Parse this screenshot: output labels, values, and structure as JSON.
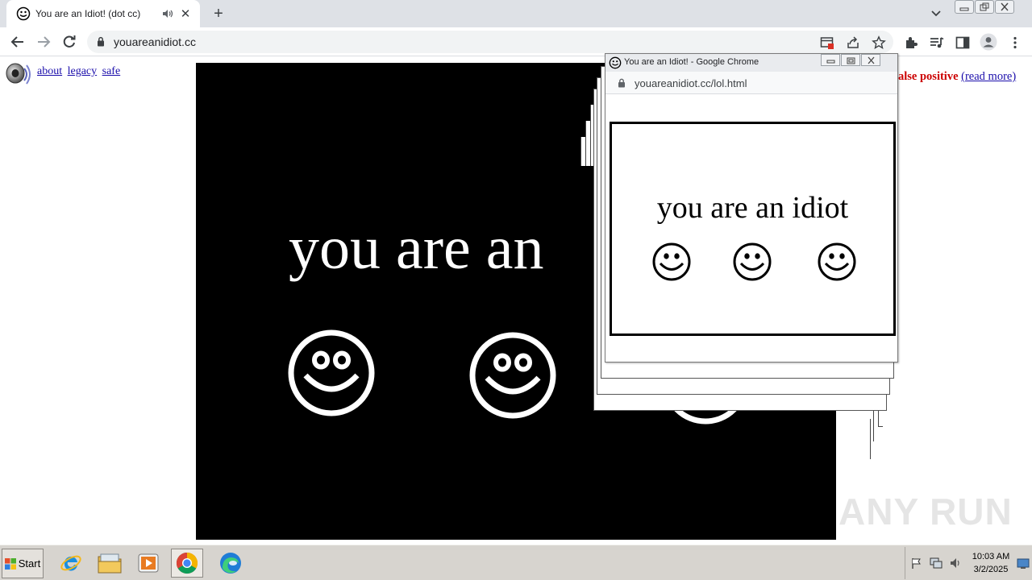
{
  "browser": {
    "tab": {
      "title": "You are an Idiot! (dot cc)"
    },
    "new_tab_label": "+",
    "address": {
      "url": "youareanidiot.cc"
    }
  },
  "page": {
    "links": [
      "about",
      "legacy",
      "safe"
    ],
    "false_positive_text": "alse positive",
    "read_more_text": "(read more)",
    "banner_text": "you are an",
    "watermark": "ANY RUN"
  },
  "popup": {
    "title": "You are an Idiot! - Google Chrome",
    "url": "youareanidiot.cc/lol.html",
    "message": "you are an idiot"
  },
  "taskbar": {
    "start_label": "Start",
    "time": "10:03 AM",
    "date": "3/2/2025"
  },
  "colors": {
    "stage_bg": "#000000",
    "warning_red": "#cc0000",
    "link_blue": "#1a0dab"
  }
}
